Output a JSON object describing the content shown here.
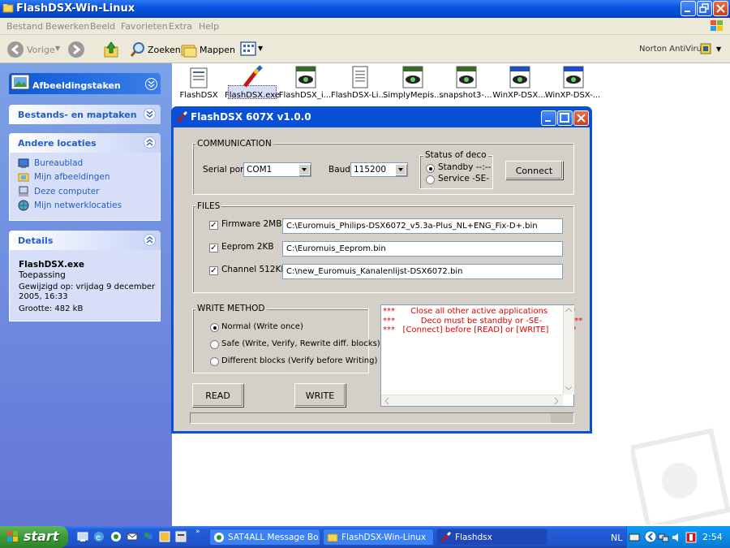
{
  "explorer": {
    "title": "FlashDSX-Win-Linux",
    "menu": [
      "Bestand",
      "Bewerken",
      "Beeld",
      "Favorieten",
      "Extra",
      "Help"
    ],
    "toolbar": {
      "back": "Vorige",
      "search": "Zoeken",
      "folders": "Mappen",
      "norton": "Norton AntiVirus"
    }
  },
  "sidebar": {
    "tasks_title": "Afbeeldingstaken",
    "file_tasks_title": "Bestands- en maptaken",
    "other_places": {
      "title": "Andere locaties",
      "items": [
        "Bureaublad",
        "Mijn afbeeldingen",
        "Deze computer",
        "Mijn netwerklocaties"
      ]
    },
    "details": {
      "title": "Details",
      "name": "FlashDSX.exe",
      "type": "Toepassing",
      "modified_1": "Gewijzigd op: vrijdag 9 december",
      "modified_2": "2005, 16:33",
      "size": "Grootte: 482 kB"
    }
  },
  "files": [
    "FlashDSX",
    "FlashDSX.exe",
    "FlashDSX_i...",
    "FlashDSX-Li...",
    "SimplyMepis...",
    "snapshot3-...",
    "WinXP-DSX...",
    "WinXP-DSX-..."
  ],
  "dialog": {
    "title": "FlashDSX 607X  v1.0.0",
    "communication": {
      "group": "COMMUNICATION",
      "serial_label": "Serial port",
      "serial_value": "COM1",
      "baud_label": "Baud",
      "baud_value": "115200",
      "status_group": "Status of deco",
      "standby": "Standby --:--",
      "service": "Service -SE-",
      "connect": "Connect"
    },
    "files": {
      "group": "FILES",
      "firmware_label": "Firmware 2MB",
      "firmware_path": "C:\\Euromuis_Philips-DSX6072_v5.3a-Plus_NL+ENG_Fix-D+.bin",
      "eeprom_label": "Eeprom 2KB",
      "eeprom_path": "C:\\Euromuis_Eeprom.bin",
      "channel_label": "Channel 512KB",
      "channel_path": "C:\\new_Euromuis_Kanalenlijst-DSX6072.bin"
    },
    "write_method": {
      "group": "WRITE METHOD",
      "normal": "Normal (Write once)",
      "safe": "Safe (Write, Verify, Rewrite diff. blocks)",
      "different": "Different blocks (Verify before Writing)"
    },
    "messages": [
      "***      Close all other active applications      ***",
      "***          Deco must be standby or -SE-           ***",
      "***   [Connect] before [READ] or [WRITE]      ***"
    ],
    "read": "READ",
    "write": "WRITE"
  },
  "taskbar": {
    "start": "start",
    "tasks": [
      "SAT4ALL Message Bo...",
      "FlashDSX-Win-Linux",
      "Flashdsx"
    ],
    "lang": "NL",
    "clock": "2:54"
  }
}
